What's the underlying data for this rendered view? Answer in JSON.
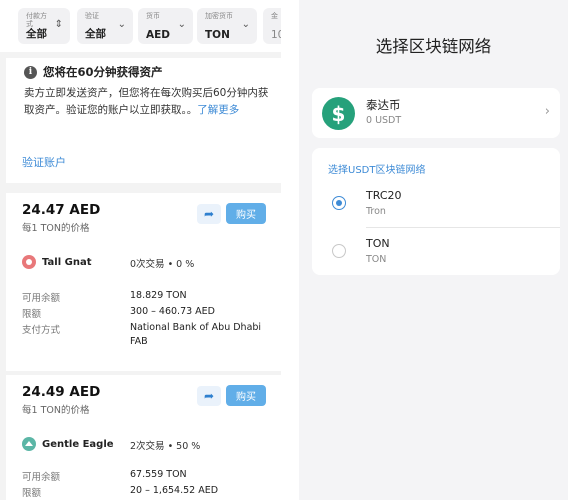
{
  "left": {
    "filters": [
      {
        "label": "付款方式",
        "value": "全部"
      },
      {
        "label": "验证",
        "value": "全部"
      },
      {
        "label": "货币",
        "value": "AED"
      },
      {
        "label": "加密货币",
        "value": "TON"
      },
      {
        "label": "金",
        "value": "10"
      }
    ],
    "notice": {
      "title": "您将在60分钟获得资产",
      "body": "卖方立即发送资产，但您将在每次购买后60分钟内获取资产。验证您的账户以立即获取。。",
      "learn_more": "了解更多",
      "verify_link": "验证账户"
    },
    "offers": [
      {
        "price": "24.47 AED",
        "per_unit": "每1 TON的价格",
        "buy_label": "购买",
        "seller": "Tall Gnat",
        "avatar_color": "#e8787a",
        "trades": "0次交易 • 0 %",
        "rows": [
          {
            "label": "可用余额",
            "value": "18.829 TON"
          },
          {
            "label": "限额",
            "value": "300 – 460.73 AED"
          },
          {
            "label": "支付方式",
            "value": "National Bank of Abu Dhabi FAB"
          }
        ]
      },
      {
        "price": "24.49 AED",
        "per_unit": "每1 TON的价格",
        "buy_label": "购买",
        "seller": "Gentle Eagle",
        "avatar_color": "#5bb6a6",
        "trades": "2次交易 • 50 %",
        "rows": [
          {
            "label": "可用余额",
            "value": "67.559 TON"
          },
          {
            "label": "限额",
            "value": "20 – 1,654.52 AED"
          }
        ]
      }
    ]
  },
  "right": {
    "title": "选择区块链网络",
    "coin": {
      "name": "泰达币",
      "balance": "0 USDT",
      "icon": "$",
      "color": "#26a17b"
    },
    "network_header": "选择USDT区块链网络",
    "networks": [
      {
        "name": "TRC20",
        "sub": "Tron",
        "selected": true
      },
      {
        "name": "TON",
        "sub": "TON",
        "selected": false
      }
    ]
  },
  "colors": {
    "accent": "#3e8bd6",
    "buy_button": "#61aee8",
    "tether_green": "#26a17b"
  }
}
